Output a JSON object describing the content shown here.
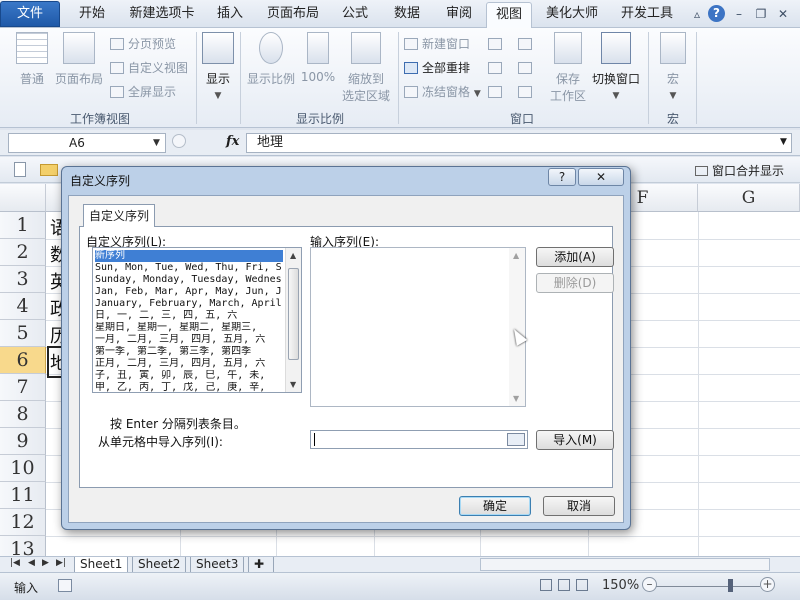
{
  "tabs": [
    {
      "label": "文件"
    },
    {
      "label": "开始"
    },
    {
      "label": "新建选项卡"
    },
    {
      "label": "插入"
    },
    {
      "label": "页面布局"
    },
    {
      "label": "公式"
    },
    {
      "label": "数据"
    },
    {
      "label": "审阅"
    },
    {
      "label": "视图"
    },
    {
      "label": "美化大师"
    },
    {
      "label": "开发工具"
    }
  ],
  "active_tab": "视图",
  "ribbon": {
    "workbook_views": {
      "label": "工作簿视图",
      "normal": "普通",
      "page_layout": "页面布局",
      "page_break_preview": "分页预览",
      "custom_views": "自定义视图",
      "full_screen": "全屏显示"
    },
    "show": {
      "label": "显示"
    },
    "zoom": {
      "label": "显示比例",
      "zoom": "显示比例",
      "hundred": "100%",
      "zoom_to_selection_1": "缩放到",
      "zoom_to_selection_2": "选定区域"
    },
    "window": {
      "label": "窗口",
      "new_window": "新建窗口",
      "arrange_all": "全部重排",
      "freeze_panes": "冻结窗格",
      "save_workspace_1": "保存",
      "save_workspace_2": "工作区",
      "switch_windows": "切换窗口"
    },
    "macros": {
      "label": "宏",
      "macros": "宏"
    }
  },
  "formula_bar": {
    "name_box": "A6",
    "fx": "fx",
    "formula": "地理"
  },
  "workbook_row": {
    "merge_windows": "窗口合并显示"
  },
  "grid": {
    "columns": [
      "F",
      "G"
    ],
    "rows": [
      "1",
      "2",
      "3",
      "4",
      "5",
      "6",
      "7",
      "8",
      "9",
      "10",
      "11",
      "12",
      "13"
    ],
    "selected_row": "6",
    "cells_col_a": [
      "语",
      "数",
      "英",
      "政",
      "历",
      "地"
    ]
  },
  "sheets": [
    "Sheet1",
    "Sheet2",
    "Sheet3"
  ],
  "active_sheet": "Sheet1",
  "status": {
    "ready": "输入",
    "zoom": "150%"
  },
  "dialog": {
    "title": "自定义序列",
    "help": "?",
    "close": "✕",
    "tab": "自定义序列",
    "list_label": "自定义序列(L):",
    "list_items": [
      "新序列",
      "Sun, Mon, Tue, Wed, Thu, Fri, S",
      "Sunday, Monday, Tuesday, Wednes",
      "Jan, Feb, Mar, Apr, May, Jun, J",
      "January, February, March, April",
      "日, 一, 二, 三, 四, 五, 六",
      "星期日, 星期一, 星期二, 星期三,",
      "一月, 二月, 三月, 四月, 五月, 六",
      "第一季, 第二季, 第三季, 第四季",
      "正月, 二月, 三月, 四月, 五月, 六",
      "子, 丑, 寅, 卯, 辰, 巳, 午, 未,",
      "甲, 乙, 丙, 丁, 戊, 己, 庚, 辛,"
    ],
    "selected_index": 0,
    "entries_label": "输入序列(E):",
    "add_button": "添加(A)",
    "delete_button": "删除(D)",
    "hint": "按 Enter 分隔列表条目。",
    "import_label": "从单元格中导入序列(I):",
    "import_button": "导入(M)",
    "ok_button": "确定",
    "cancel_button": "取消"
  }
}
